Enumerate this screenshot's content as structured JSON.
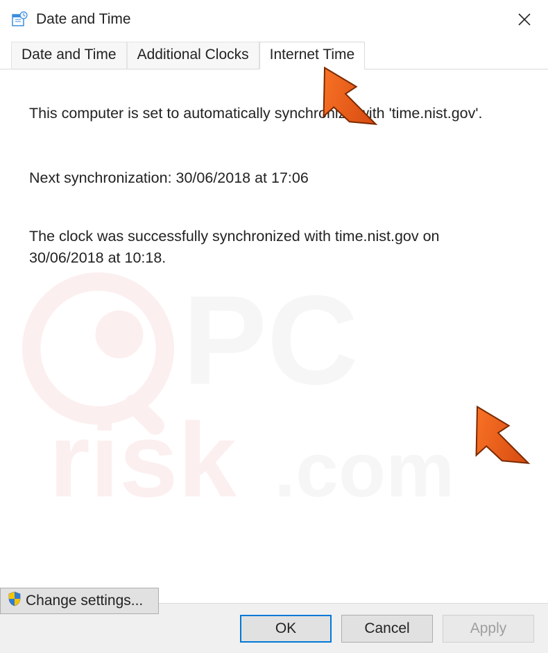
{
  "window": {
    "title": "Date and Time"
  },
  "tabs": [
    {
      "label": "Date and Time",
      "active": false
    },
    {
      "label": "Additional Clocks",
      "active": false
    },
    {
      "label": "Internet Time",
      "active": true
    }
  ],
  "content": {
    "sync_status": "This computer is set to automatically synchronize with 'time.nist.gov'.",
    "next_sync": "Next synchronization: 30/06/2018 at 17:06",
    "last_sync": "The clock was successfully synchronized with time.nist.gov on 30/06/2018 at 10:18.",
    "change_settings_label": "Change settings..."
  },
  "footer": {
    "ok": "OK",
    "cancel": "Cancel",
    "apply": "Apply"
  },
  "icons": {
    "shield": "uac-shield-icon",
    "close": "close-icon",
    "app": "date-time-icon"
  },
  "watermark_text": "PCrisk.com"
}
